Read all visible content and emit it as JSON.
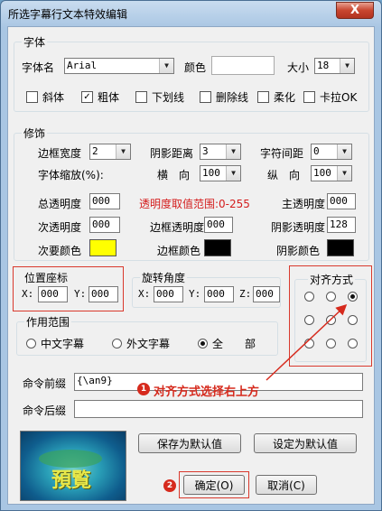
{
  "window": {
    "title": "所选字幕行文本特效编辑",
    "close_glyph": "X"
  },
  "font": {
    "legend": "字体",
    "name_label": "字体名",
    "name_value": "Arial",
    "color_label": "颜色",
    "size_label": "大小",
    "size_value": "18",
    "options": [
      {
        "label": "斜体",
        "checked": false
      },
      {
        "label": "粗体",
        "checked": true
      },
      {
        "label": "下划线",
        "checked": false
      },
      {
        "label": "删除线",
        "checked": false
      },
      {
        "label": "柔化",
        "checked": false
      },
      {
        "label": "卡拉OK",
        "checked": false
      }
    ],
    "check_mark": "✓"
  },
  "decor": {
    "legend": "修饰",
    "border_width_label": "边框宽度",
    "border_width_value": "2",
    "shadow_dist_label": "阴影距离",
    "shadow_dist_value": "3",
    "char_spacing_label": "字符间距",
    "char_spacing_value": "0",
    "scale_label": "字体缩放(%):",
    "scale_h_label": "横　向",
    "scale_h_value": "100",
    "scale_v_label": "纵　向",
    "scale_v_value": "100",
    "total_alpha_label": "总透明度",
    "total_alpha_value": "000",
    "alpha_range_note": "透明度取值范围:0-255",
    "primary_alpha_label": "主透明度",
    "primary_alpha_value": "000",
    "secondary_alpha_label": "次透明度",
    "secondary_alpha_value": "000",
    "border_alpha_label": "边框透明度",
    "border_alpha_value": "000",
    "shadow_alpha_label": "阴影透明度",
    "shadow_alpha_value": "128",
    "secondary_color_label": "次要颜色",
    "border_color_label": "边框颜色",
    "shadow_color_label": "阴影颜色"
  },
  "colors": {
    "font_color": "#ffffff",
    "secondary_color": "#ffff00",
    "border_color": "#000000",
    "shadow_color": "#000000"
  },
  "position": {
    "legend": "位置座标",
    "x_label": "X:",
    "x_value": "000",
    "y_label": "Y:",
    "y_value": "000"
  },
  "rotation": {
    "legend": "旋转角度",
    "x_label": "X:",
    "x_value": "000",
    "y_label": "Y:",
    "y_value": "000",
    "z_label": "Z:",
    "z_value": "000"
  },
  "alignment": {
    "legend": "对齐方式",
    "selected": "top-right"
  },
  "scope": {
    "legend": "作用范围",
    "options": [
      "中文字幕",
      "外文字幕",
      "全　　部"
    ],
    "selected_index": 2
  },
  "command": {
    "prefix_label": "命令前缀",
    "prefix_value": "{\\an9}",
    "suffix_label": "命令后缀",
    "suffix_value": ""
  },
  "preview": {
    "text": "預覧"
  },
  "buttons": {
    "save_default": "保存为默认值",
    "set_default": "设定为默认值",
    "ok": "确定(O)",
    "cancel": "取消(C)"
  },
  "annotations": {
    "note1_number": "1",
    "note1_text": "对齐方式选择右上方",
    "note2_number": "2",
    "accent": "#d62a1d"
  },
  "icons": {
    "dropdown": "chevron-down-icon"
  }
}
